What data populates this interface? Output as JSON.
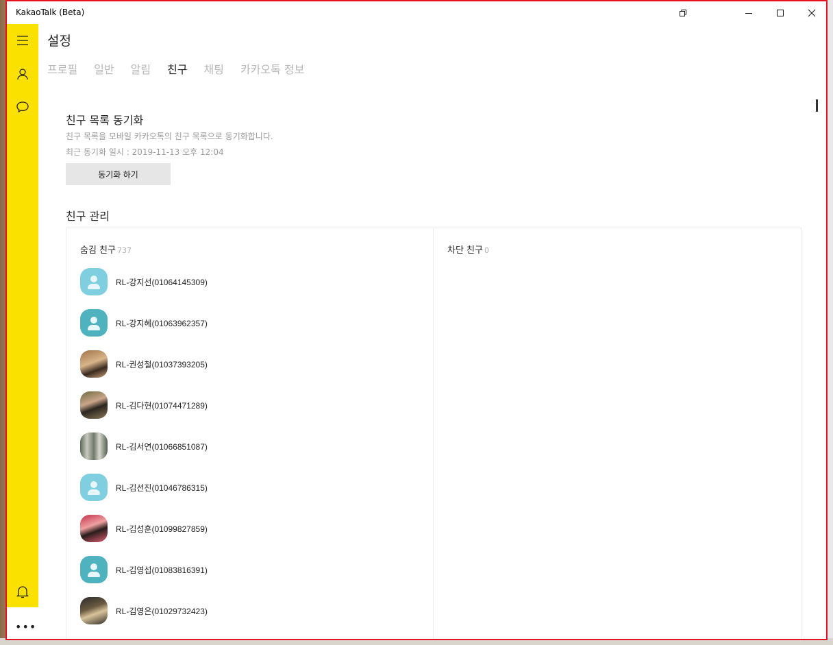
{
  "window": {
    "title": "KakaoTalk (Beta)"
  },
  "page": {
    "title": "설정"
  },
  "tabs": [
    {
      "label": "프로필",
      "active": false
    },
    {
      "label": "일반",
      "active": false
    },
    {
      "label": "알림",
      "active": false
    },
    {
      "label": "친구",
      "active": true
    },
    {
      "label": "채팅",
      "active": false
    },
    {
      "label": "카카오톡 정보",
      "active": false
    }
  ],
  "sync": {
    "title": "친구 목록 동기화",
    "description": "친구 목록을 모바일 카카오톡의 친구 목록으로 동기화합니다.",
    "last_sync": "최근 동기화 일시 : 2019-11-13 오후 12:04",
    "button_label": "동기화 하기"
  },
  "manage": {
    "title": "친구 관리",
    "hidden": {
      "label": "숨김 친구",
      "count": "737",
      "friends": [
        {
          "name": "RL-강지선(01064145309)",
          "avatar": "placeholder-light"
        },
        {
          "name": "RL-강지혜(01063962357)",
          "avatar": "placeholder-dark"
        },
        {
          "name": "RL-권성철(01037393205)",
          "avatar": "photo"
        },
        {
          "name": "RL-김다현(01074471289)",
          "avatar": "photo"
        },
        {
          "name": "RL-김서연(01066851087)",
          "avatar": "photo"
        },
        {
          "name": "RL-김선진(01046786315)",
          "avatar": "placeholder-light"
        },
        {
          "name": "RL-김성훈(01099827859)",
          "avatar": "photo"
        },
        {
          "name": "RL-김영섭(01083816391)",
          "avatar": "placeholder-dark"
        },
        {
          "name": "RL-김영은(01029732423)",
          "avatar": "photo"
        }
      ]
    },
    "blocked": {
      "label": "차단 친구",
      "count": "0"
    }
  },
  "sidebar": {
    "icons": [
      "menu-icon",
      "friends-icon",
      "chat-icon",
      "bell-icon",
      "more-icon"
    ]
  },
  "colors": {
    "sidebar": "#fae100",
    "window_border": "#e81123",
    "avatar_light": "#80cfe0",
    "avatar_dark": "#4fb3bf"
  }
}
